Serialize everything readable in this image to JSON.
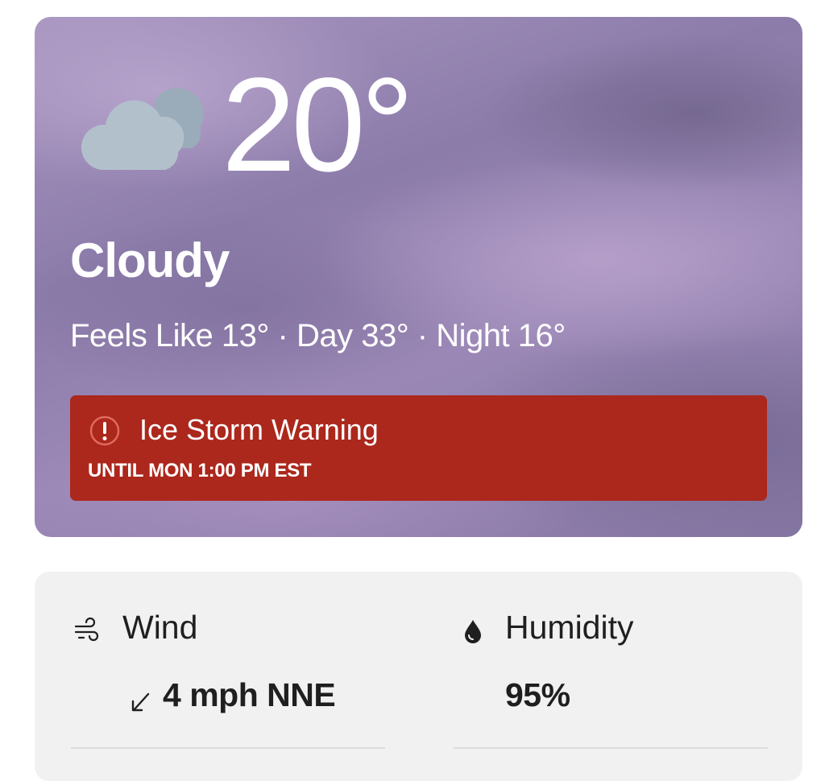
{
  "current": {
    "temperature": "20°",
    "phrase": "Cloudy",
    "feels_like_line": "Feels Like 13° · Day 33° · Night 16°",
    "condition_icon": "cloudy-icon"
  },
  "alert": {
    "title": "Ice Storm Warning",
    "until": "UNTIL MON 1:00 PM EST",
    "icon": "alert-icon",
    "color": "#ac271c"
  },
  "details": {
    "wind": {
      "label": "Wind",
      "value": "4 mph NNE",
      "icon": "wind-icon",
      "direction_icon": "arrow-down-left-icon"
    },
    "humidity": {
      "label": "Humidity",
      "value": "95%",
      "icon": "droplet-icon"
    }
  }
}
